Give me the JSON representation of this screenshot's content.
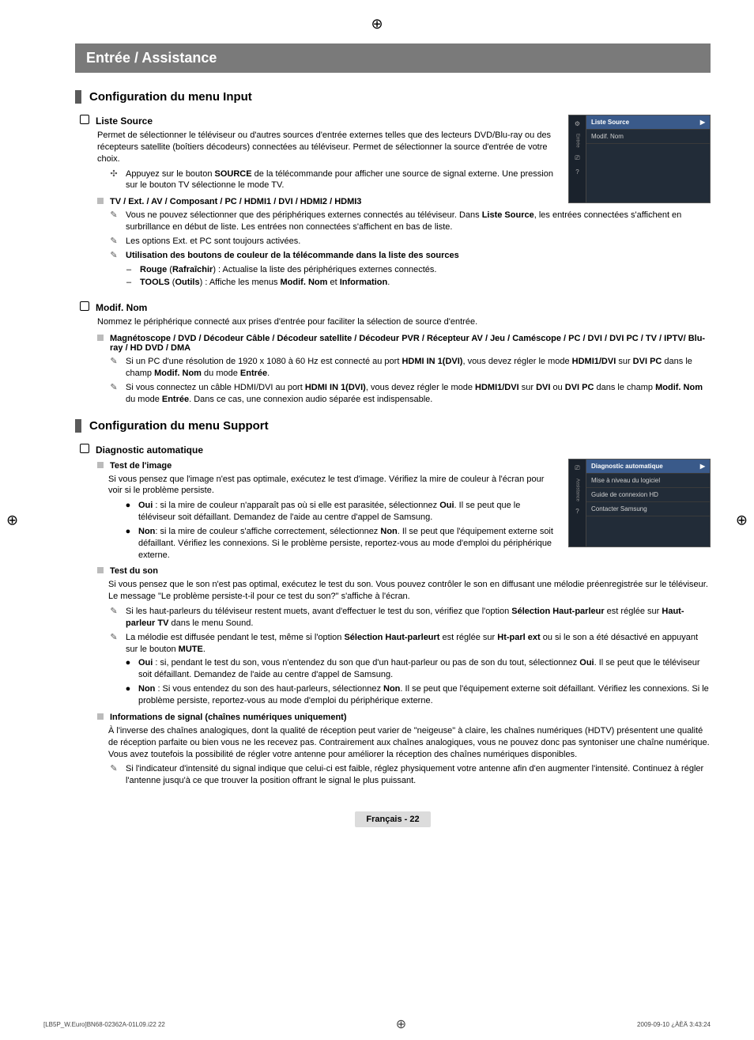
{
  "banner": "Entrée / Assistance",
  "section_input": "Configuration du menu Input",
  "liste_source": {
    "title": "Liste Source",
    "intro": "Permet de sélectionner le téléviseur ou d'autres sources d'entrée externes telles que des lecteurs DVD/Blu-ray ou des récepteurs satellite (boîtiers décodeurs) connectées au téléviseur. Permet de sélectionner la source d'entrée de votre choix.",
    "note_source_btn_pre": "Appuyez sur le bouton ",
    "note_source_btn_bold": "SOURCE",
    "note_source_btn_post": " de la télécommande pour afficher une source de signal externe. Une pression sur le bouton TV sélectionne le mode TV.",
    "tv_list": "TV / Ext. / AV / Composant / PC / HDMI1 / DVI / HDMI2 / HDMI3",
    "n1_pre": "Vous ne pouvez sélectionner que des périphériques externes connectés au téléviseur. Dans ",
    "n1_bold": "Liste Source",
    "n1_post": ", les entrées connectées s'affichent en surbrillance en début de liste. Les entrées non connectées s'affichent en bas de liste.",
    "n2": "Les options Ext. et PC sont toujours activées.",
    "n3": "Utilisation des boutons de couleur de la télécommande dans la liste des sources",
    "n3a_pre": "Rouge",
    "n3a_mid": " (",
    "n3a_b2": "Rafraîchir",
    "n3a_post": ") : Actualise la liste des périphériques externes connectés.",
    "n3b_pre": "TOOLS",
    "n3b_mid": " (",
    "n3b_b2": "Outils",
    "n3b_post": ") : Affiche les menus ",
    "n3b_b3": "Modif. Nom",
    "n3b_and": " et ",
    "n3b_b4": "Information",
    "n3b_end": "."
  },
  "modif_nom": {
    "title": "Modif. Nom",
    "intro": "Nommez le périphérique connecté aux prises d'entrée pour faciliter la sélection de source d'entrée.",
    "list": "Magnétoscope / DVD / Décodeur Câble / Décodeur satellite / Décodeur PVR / Récepteur AV / Jeu / Caméscope / PC / DVI / DVI PC / TV / IPTV/ Blu-ray / HD DVD / DMA",
    "n1_pre": "Si un PC d'une résolution de 1920 x 1080 à 60 Hz est connecté au port ",
    "n1_b1": "HDMI IN 1(DVI)",
    "n1_mid": ", vous devez régler le mode ",
    "n1_b2": "HDMI1/DVI",
    "n1_mid2": " sur ",
    "n1_b3": "DVI PC",
    "n1_mid3": " dans le champ ",
    "n1_b4": "Modif. Nom",
    "n1_mid4": " du mode ",
    "n1_b5": "Entrée",
    "n1_end": ".",
    "n2_pre": "Si vous connectez un câble HDMI/DVI au port ",
    "n2_b1": "HDMI IN 1(DVI)",
    "n2_mid": ", vous devez régler le mode ",
    "n2_b2": "HDMI1/DVI",
    "n2_mid2": " sur ",
    "n2_b3": "DVI",
    "n2_or": " ou ",
    "n2_b4": "DVI PC",
    "n2_mid3": " dans le champ ",
    "n2_b5": "Modif. Nom",
    "n2_mid4": " du mode ",
    "n2_b6": "Entrée",
    "n2_end": ". Dans ce cas, une connexion audio séparée est indispensable."
  },
  "section_support": "Configuration du menu Support",
  "diag": {
    "title": "Diagnostic automatique",
    "test_image": "Test de l'image",
    "ti_intro": "Si vous pensez que l'image n'est pas optimale, exécutez le test d'image. Vérifiez la mire de couleur à l'écran pour voir si le problème persiste.",
    "ti_oui_pre": "Oui",
    "ti_oui_body": " : si la mire de couleur n'apparaît pas où si elle est parasitée, sélectionnez ",
    "ti_oui_b2": "Oui",
    "ti_oui_post": ". Il se peut que le téléviseur soit défaillant. Demandez de l'aide au centre d'appel de Samsung.",
    "ti_non_pre": "Non",
    "ti_non_body": ": si la mire de couleur s'affiche correctement, sélectionnez ",
    "ti_non_b2": "Non",
    "ti_non_post": ". Il se peut que l'équipement externe soit défaillant. Vérifiez les connexions. Si le problème persiste, reportez-vous au mode d'emploi du périphérique externe.",
    "test_son": "Test du son",
    "ts_intro": "Si vous pensez que le son n'est pas optimal, exécutez le test du son. Vous pouvez contrôler le son en diffusant une mélodie préenregistrée sur le téléviseur. Le message \"Le problème persiste-t-il pour ce test du son?\" s'affiche à l'écran.",
    "ts_n1_pre": "Si les haut-parleurs du téléviseur restent muets, avant d'effectuer le test du son, vérifiez que l'option ",
    "ts_n1_b1": "Sélection Haut-parleur",
    "ts_n1_mid": " est réglée sur ",
    "ts_n1_b2": "Haut-parleur TV",
    "ts_n1_post": " dans le menu Sound.",
    "ts_n2_pre": "La mélodie est diffusée pendant le test, même si l'option ",
    "ts_n2_b1": "Sélection Haut-parleurt",
    "ts_n2_mid": " est réglée sur ",
    "ts_n2_b2": "Ht-parl ext",
    "ts_n2_post": " ou si le son a été désactivé en appuyant sur le bouton ",
    "ts_n2_b3": "MUTE",
    "ts_n2_end": ".",
    "ts_oui_pre": "Oui",
    "ts_oui_body": " : si, pendant le test du son, vous n'entendez du son que d'un haut-parleur ou pas de son du tout, sélectionnez ",
    "ts_oui_b2": "Oui",
    "ts_oui_post": ". Il se peut que le téléviseur soit défaillant. Demandez de l'aide au centre d'appel de Samsung.",
    "ts_non_pre": "Non",
    "ts_non_body": " : Si vous entendez du son des haut-parleurs, sélectionnez ",
    "ts_non_b2": "Non",
    "ts_non_post": ". Il se peut que l'équipement externe soit défaillant. Vérifiez les connexions. Si le problème persiste, reportez-vous au mode d'emploi du périphérique externe.",
    "info_signal": "Informations de signal (chaînes numériques uniquement)",
    "is_intro": "À l'inverse des chaînes analogiques, dont la qualité de réception peut varier de \"neigeuse\" à claire, les chaînes numériques (HDTV) présentent une qualité de réception parfaite ou bien vous ne les recevez pas. Contrairement aux chaînes analogiques, vous ne pouvez donc pas syntoniser une chaîne numérique. Vous avez toutefois la possibilité de régler votre antenne pour améliorer la réception des chaînes numériques disponibles.",
    "is_n1": "Si l'indicateur d'intensité du signal indique que celui-ci est faible, réglez physiquement votre antenne afin d'en augmenter l'intensité. Continuez à régler l'antenne jusqu'à ce que trouver la position offrant le signal le plus puissant."
  },
  "osd1": {
    "side_label": "Entrée",
    "rows": [
      "Liste Source",
      "Modif. Nom"
    ]
  },
  "osd2": {
    "side_label": "Assistance",
    "rows": [
      "Diagnostic automatique",
      "Mise à niveau du logiciel",
      "Guide de connexion HD",
      "Contacter Samsung"
    ]
  },
  "footer_page": "Français - 22",
  "print_footer": {
    "left": "[LB5P_W.Euro]BN68-02362A-01L09.i22   22",
    "right": "2009-09-10   ¿ÀÈÄ 3:43:24"
  }
}
